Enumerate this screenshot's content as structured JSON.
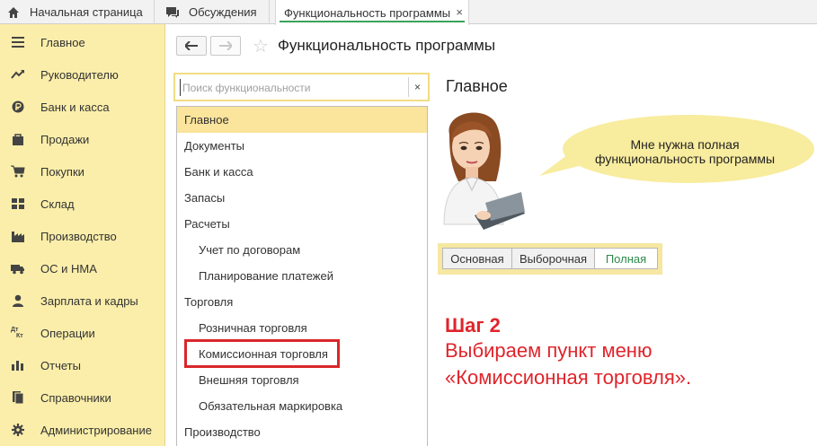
{
  "tabs": {
    "home": "Начальная страница",
    "discussions": "Обсуждения",
    "active": "Функциональность программы",
    "close": "×"
  },
  "sidebar": {
    "items": [
      {
        "label": "Главное",
        "icon": "menu-icon"
      },
      {
        "label": "Руководителю",
        "icon": "trend-icon"
      },
      {
        "label": "Банк и касса",
        "icon": "ruble-icon"
      },
      {
        "label": "Продажи",
        "icon": "bag-icon"
      },
      {
        "label": "Покупки",
        "icon": "cart-icon"
      },
      {
        "label": "Склад",
        "icon": "warehouse-icon"
      },
      {
        "label": "Производство",
        "icon": "factory-icon"
      },
      {
        "label": "ОС и НМА",
        "icon": "truck-icon"
      },
      {
        "label": "Зарплата и кадры",
        "icon": "person-icon"
      },
      {
        "label": "Операции",
        "icon": "dt-kt-icon"
      },
      {
        "label": "Отчеты",
        "icon": "bar-chart-icon"
      },
      {
        "label": "Справочники",
        "icon": "books-icon"
      },
      {
        "label": "Администрирование",
        "icon": "gear-icon"
      }
    ],
    "dt_kt": {
      "dt": "Дт",
      "kt": "Кт"
    }
  },
  "header": {
    "title": "Функциональность программы"
  },
  "search": {
    "placeholder": "Поиск функциональности",
    "value": "",
    "clear": "×"
  },
  "list": {
    "items": [
      {
        "label": "Главное",
        "level": 0,
        "selected": true
      },
      {
        "label": "Документы",
        "level": 0
      },
      {
        "label": "Банк и касса",
        "level": 0
      },
      {
        "label": "Запасы",
        "level": 0
      },
      {
        "label": "Расчеты",
        "level": 0
      },
      {
        "label": "Учет по договорам",
        "level": 1
      },
      {
        "label": "Планирование платежей",
        "level": 1
      },
      {
        "label": "Торговля",
        "level": 0
      },
      {
        "label": "Розничная торговля",
        "level": 1
      },
      {
        "label": "Комиссионная торговля",
        "level": 1,
        "highlighted": true
      },
      {
        "label": "Внешняя торговля",
        "level": 1
      },
      {
        "label": "Обязательная маркировка",
        "level": 1
      },
      {
        "label": "Производство",
        "level": 0
      }
    ]
  },
  "main": {
    "section_title": "Главное",
    "bubble_line1": "Мне нужна полная",
    "bubble_line2": "функциональность программы",
    "modes": {
      "basic": "Основная",
      "selective": "Выборочная",
      "full": "Полная"
    },
    "selected_mode": "full"
  },
  "annotation": {
    "step": "Шаг 2",
    "line1": "Выбираем пункт меню",
    "line2": "«Комиссионная торговля»."
  },
  "colors": {
    "sidebar_bg": "#fbeeaa",
    "selected_row": "#fbe49b",
    "accent_green": "#3aa35a",
    "annotation_red": "#e0242b"
  }
}
